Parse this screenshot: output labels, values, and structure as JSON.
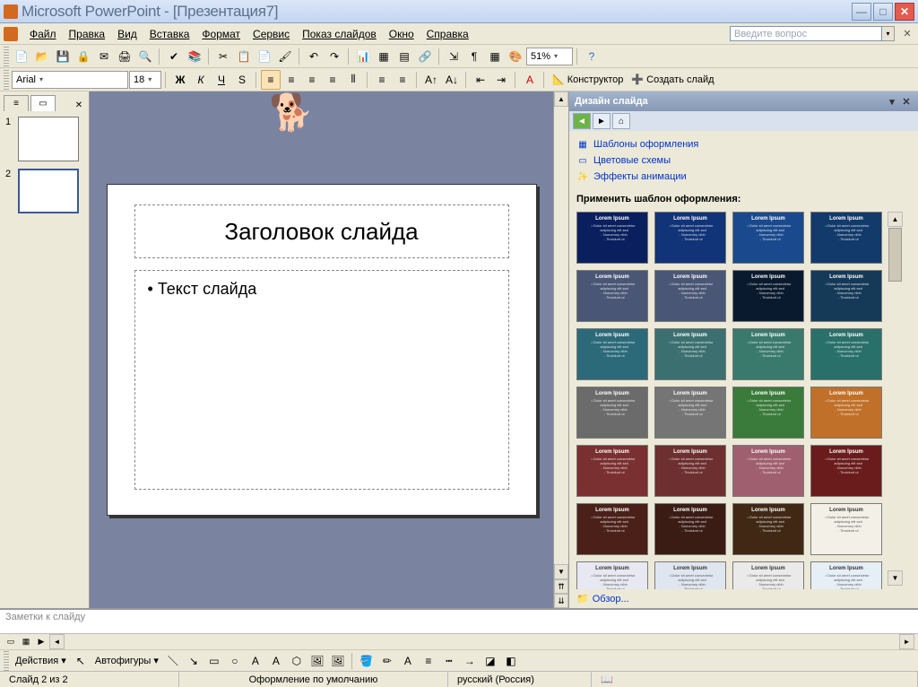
{
  "titlebar": {
    "title": "Microsoft PowerPoint - [Презентация7]"
  },
  "menubar": {
    "items": [
      "Файл",
      "Правка",
      "Вид",
      "Вставка",
      "Формат",
      "Сервис",
      "Показ слайдов",
      "Окно",
      "Справка"
    ],
    "question_placeholder": "Введите вопрос"
  },
  "toolbar1": {
    "zoom": "51%"
  },
  "toolbar2": {
    "font": "Arial",
    "size": "18",
    "designer_label": "Конструктор",
    "newslide_label": "Создать слайд"
  },
  "thumbs": {
    "slides": [
      {
        "n": "1"
      },
      {
        "n": "2",
        "selected": true
      }
    ]
  },
  "slide": {
    "title": "Заголовок слайда",
    "body": "Текст слайда"
  },
  "notes": {
    "placeholder": "Заметки к слайду"
  },
  "taskpane": {
    "title": "Дизайн слайда",
    "links": {
      "templates": "Шаблоны оформления",
      "colors": "Цветовые схемы",
      "animation": "Эффекты анимации"
    },
    "apply_label": "Применить шаблон оформления:",
    "sample_title": "Lorem Ipsum",
    "browse": "Обзор...",
    "template_colors": [
      "#0a1f5e",
      "#113377",
      "#1a4a8d",
      "#123a6b",
      "#4a5675",
      "#4a5675",
      "#0a1a2e",
      "#153a58",
      "#2c6a7a",
      "#3c7070",
      "#3a7a6d",
      "#2a706a",
      "#6b6b6b",
      "#757575",
      "#3a7a3a",
      "#c07028",
      "#7a3030",
      "#6d2f2f",
      "#a05f6f",
      "#6a1c1c",
      "#4a2018",
      "#3a1c15",
      "#402814",
      "#f3f0e8",
      "#e8e8f2",
      "#e0e6ef",
      "#eaeaea",
      "#e6eef6"
    ]
  },
  "drawbar": {
    "actions": "Действия",
    "autoshapes": "Автофигуры"
  },
  "statusbar": {
    "slideinfo": "Слайд 2 из 2",
    "design": "Оформление по умолчанию",
    "lang": "русский (Россия)"
  }
}
